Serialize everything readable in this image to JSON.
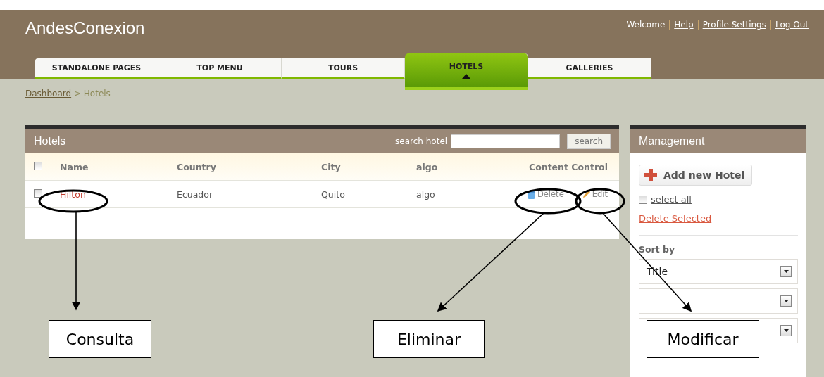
{
  "header": {
    "site_title": "AndesConexion",
    "welcome": "Welcome",
    "links": [
      "Help",
      "Profile Settings",
      "Log Out"
    ]
  },
  "tabs": [
    {
      "label": "STANDALONE PAGES",
      "selected": false
    },
    {
      "label": "TOP MENU",
      "selected": false
    },
    {
      "label": "TOURS",
      "selected": false
    },
    {
      "label": "HOTELS",
      "selected": true
    },
    {
      "label": "GALLERIES",
      "selected": false
    }
  ],
  "breadcrumb": {
    "link": "Dashboard",
    "separator": ">",
    "current": "Hotels"
  },
  "hotels_panel": {
    "title": "Hotels",
    "search_label": "search hotel",
    "search_button": "search",
    "select_all_checked": false,
    "columns": [
      "Name",
      "Country",
      "City",
      "algo",
      "Content Control"
    ],
    "rows": [
      {
        "checked": false,
        "name": "Hilton",
        "country": "Ecuador",
        "city": "Quito",
        "algo": "algo",
        "delete": "Delete",
        "edit": "Edit"
      }
    ]
  },
  "management": {
    "title": "Management",
    "add_button": "Add new Hotel",
    "select_all": "select all",
    "select_all_checked": false,
    "delete_selected": "Delete Selected",
    "sort_label": "Sort by",
    "sort_selects": [
      {
        "kind": "select",
        "value": "Title"
      },
      {
        "kind": "select"
      },
      {
        "kind": "select"
      }
    ]
  },
  "annotations": [
    {
      "label": "Consulta"
    },
    {
      "label": "Eliminar"
    },
    {
      "label": "Modificar"
    }
  ]
}
